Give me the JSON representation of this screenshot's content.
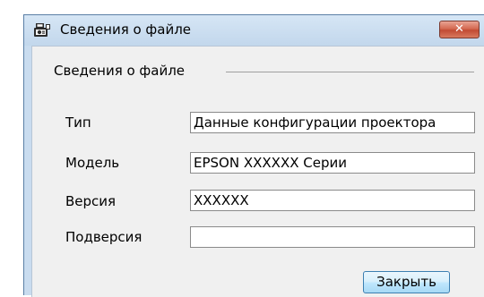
{
  "window": {
    "title": "Сведения о файле",
    "close_glyph": "✕"
  },
  "group": {
    "title": "Сведения о файле"
  },
  "fields": [
    {
      "label": "Тип",
      "value": "Данные конфигурации проектора"
    },
    {
      "label": "Модель",
      "value": "EPSON XXXXXX Серии"
    },
    {
      "label": "Версия",
      "value": "XXXXXX"
    },
    {
      "label": "Подверсия",
      "value": ""
    }
  ],
  "buttons": {
    "close_label": "Закрыть"
  },
  "icons": {
    "app": "projector-file-icon",
    "close": "close-icon"
  },
  "colors": {
    "titlebar": "#c9dcef",
    "close_button": "#c9503a",
    "dialog_bg": "#f0f0f0"
  }
}
